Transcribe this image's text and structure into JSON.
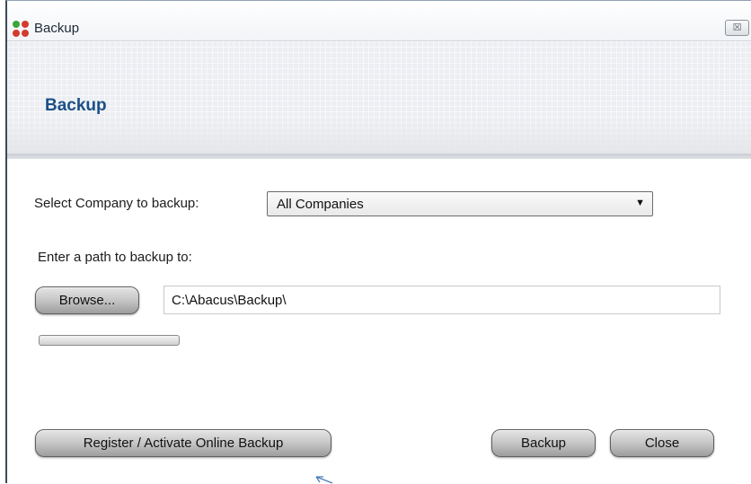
{
  "window": {
    "title": "Backup",
    "close_glyph": "☒"
  },
  "header": {
    "title": "Backup"
  },
  "form": {
    "company_label": "Select Company to backup:",
    "company_selected": "All Companies",
    "path_label": "Enter a path to backup to:",
    "browse_label": "Browse...",
    "path_value": "C:\\Abacus\\Backup\\",
    "progress": 0
  },
  "buttons": {
    "register_label": "Register / Activate Online Backup",
    "backup_label": "Backup",
    "close_label": "Close"
  },
  "colors": {
    "header_title": "#1c4f86",
    "icon_dots": [
      "#3aa63a",
      "#d23b2e",
      "#d23b2e",
      "#d23b2e"
    ]
  }
}
